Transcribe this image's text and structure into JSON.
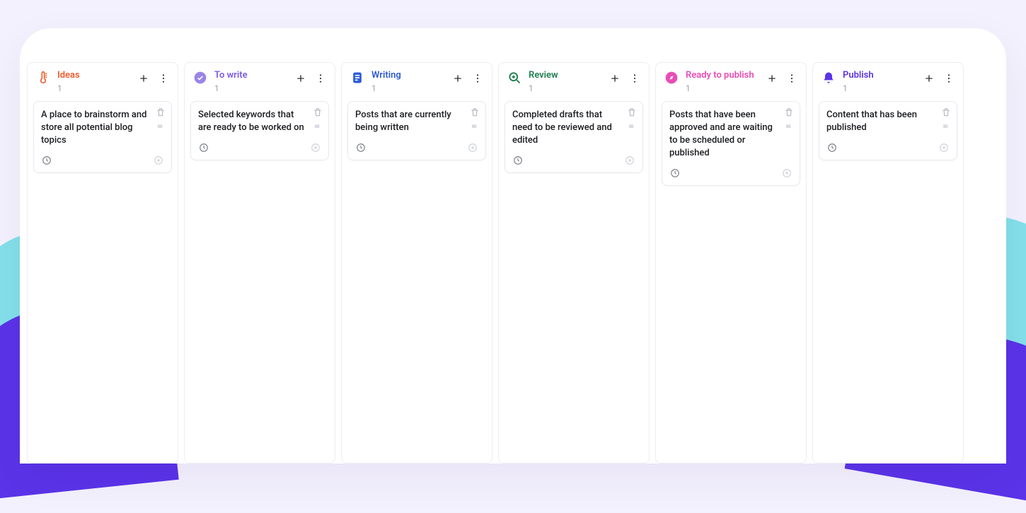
{
  "colors": {
    "ideas": "#f15c2b",
    "to_write": "#7b5be8",
    "writing": "#2b5bd7",
    "review": "#1c7f4c",
    "ready": "#e94db5",
    "publish": "#5b33e8"
  },
  "board": {
    "columns": [
      {
        "id": "ideas",
        "title": "Ideas",
        "count": "1",
        "icon": "thermometer-icon",
        "card": {
          "text": "A place to brainstorm and store all potential blog topics"
        }
      },
      {
        "id": "to_write",
        "title": "To write",
        "count": "1",
        "icon": "check-circle-icon",
        "card": {
          "text": "Selected keywords that are ready to be worked on"
        }
      },
      {
        "id": "writing",
        "title": "Writing",
        "count": "1",
        "icon": "document-icon",
        "card": {
          "text": "Posts that are currently being written"
        }
      },
      {
        "id": "review",
        "title": "Review",
        "count": "1",
        "icon": "search-plus-icon",
        "card": {
          "text": "Completed drafts that need to be reviewed and edited"
        }
      },
      {
        "id": "ready",
        "title": "Ready to publish",
        "count": "1",
        "icon": "compass-icon",
        "card": {
          "text": "Posts that have been approved and are waiting to be scheduled or published"
        }
      },
      {
        "id": "publish",
        "title": "Publish",
        "count": "1",
        "icon": "bell-icon",
        "card": {
          "text": "Content that has been published"
        }
      }
    ]
  }
}
